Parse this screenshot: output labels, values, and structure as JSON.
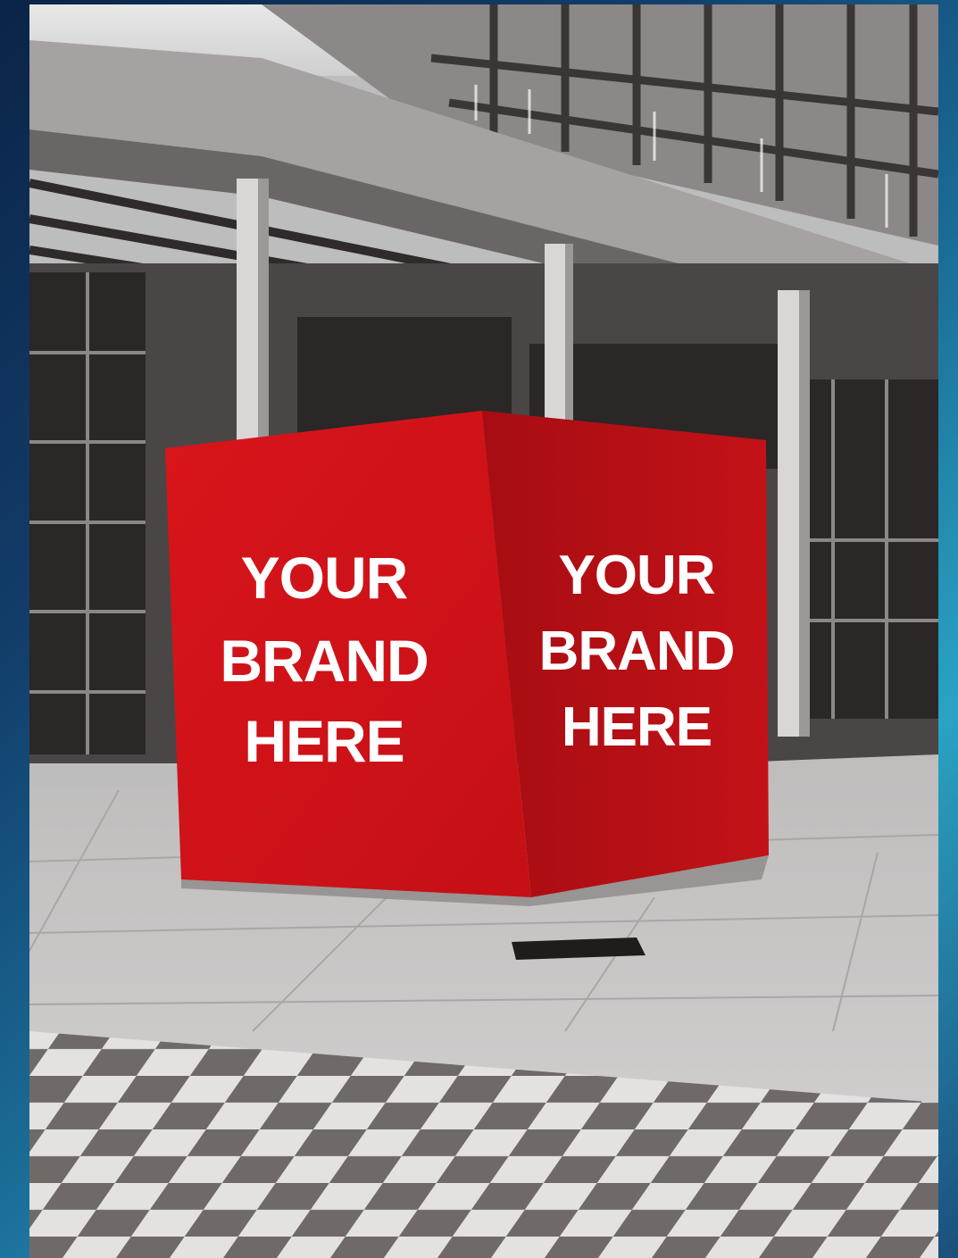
{
  "image": {
    "frame_gradient": [
      "#0b2447",
      "#123e6b",
      "#1b6f9a",
      "#2aa3c4",
      "#1a4f7a"
    ],
    "accent_red": "#d21319",
    "accent_red_dark": "#a10d12"
  },
  "cube": {
    "left_face": {
      "line1": "YOUR",
      "line2": "BRAND",
      "line3": "HERE"
    },
    "right_face": {
      "line1": "YOUR",
      "line2": "BRAND",
      "line3": "HERE"
    }
  }
}
